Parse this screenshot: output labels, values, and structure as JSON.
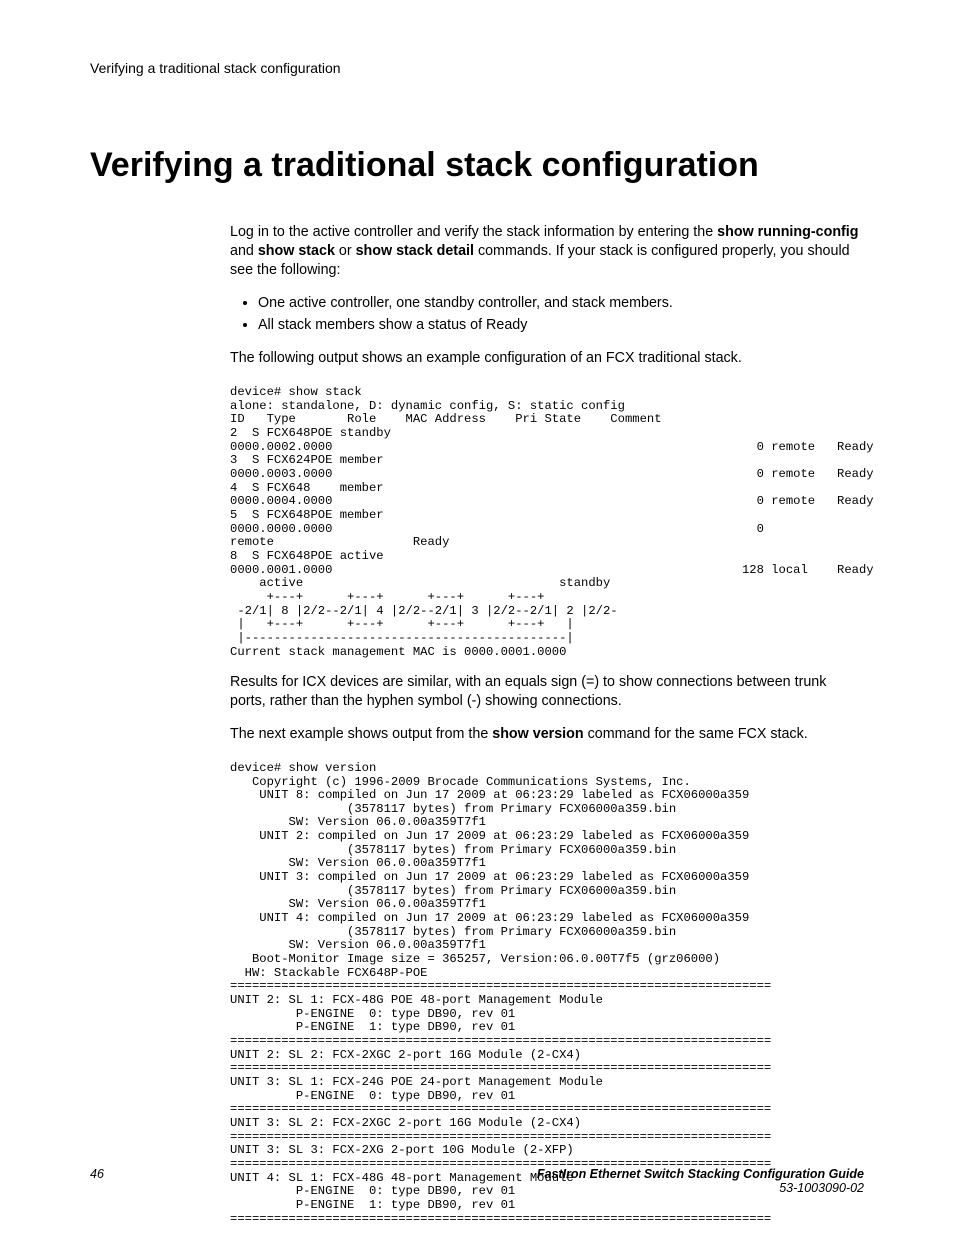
{
  "runningHead": "Verifying a traditional stack configuration",
  "title": "Verifying a traditional stack configuration",
  "intro": {
    "pre1": "Log in to the active controller and verify the stack information by entering the ",
    "cmd1": "show running-config",
    "mid1": " and ",
    "cmd2": "show stack",
    "mid2": " or ",
    "cmd3": "show stack detail",
    "post1": " commands. If your stack is configured properly, you should see the following:"
  },
  "bullets": [
    "One active controller, one standby controller, and stack members.",
    "All stack members show a status of Ready"
  ],
  "para2": "The following output shows an example configuration of an FCX traditional stack.",
  "code1": "device# show stack\nalone: standalone, D: dynamic config, S: static config\nID   Type       Role    MAC Address    Pri State    Comment\n2  S FCX648POE standby\n0000.0002.0000                                                          0 remote   Ready\n3  S FCX624POE member\n0000.0003.0000                                                          0 remote   Ready\n4  S FCX648    member\n0000.0004.0000                                                          0 remote   Ready\n5  S FCX648POE member\n0000.0000.0000                                                          0\nremote                   Ready\n8  S FCX648POE active\n0000.0001.0000                                                        128 local    Ready\n    active                                   standby\n     +---+      +---+      +---+      +---+\n -2/1| 8 |2/2--2/1| 4 |2/2--2/1| 3 |2/2--2/1| 2 |2/2-\n |   +---+      +---+      +---+      +---+   |\n |--------------------------------------------|\nCurrent stack management MAC is 0000.0001.0000",
  "para3": "Results for ICX devices are similar, with an equals sign (=) to show connections between trunk ports, rather than the hyphen symbol (-) showing connections.",
  "para4": {
    "pre": "The next example shows output from the ",
    "cmd": "show version",
    "post": " command for the same FCX stack."
  },
  "code2": "device# show version\n   Copyright (c) 1996-2009 Brocade Communications Systems, Inc.\n    UNIT 8: compiled on Jun 17 2009 at 06:23:29 labeled as FCX06000a359\n                (3578117 bytes) from Primary FCX06000a359.bin\n        SW: Version 06.0.00a359T7f1\n    UNIT 2: compiled on Jun 17 2009 at 06:23:29 labeled as FCX06000a359\n                (3578117 bytes) from Primary FCX06000a359.bin\n        SW: Version 06.0.00a359T7f1\n    UNIT 3: compiled on Jun 17 2009 at 06:23:29 labeled as FCX06000a359\n                (3578117 bytes) from Primary FCX06000a359.bin\n        SW: Version 06.0.00a359T7f1\n    UNIT 4: compiled on Jun 17 2009 at 06:23:29 labeled as FCX06000a359\n                (3578117 bytes) from Primary FCX06000a359.bin\n        SW: Version 06.0.00a359T7f1\n   Boot-Monitor Image size = 365257, Version:06.0.00T7f5 (grz06000)\n  HW: Stackable FCX648P-POE\n==========================================================================\nUNIT 2: SL 1: FCX-48G POE 48-port Management Module\n         P-ENGINE  0: type DB90, rev 01\n         P-ENGINE  1: type DB90, rev 01\n==========================================================================\nUNIT 2: SL 2: FCX-2XGC 2-port 16G Module (2-CX4)\n==========================================================================\nUNIT 3: SL 1: FCX-24G POE 24-port Management Module\n         P-ENGINE  0: type DB90, rev 01\n==========================================================================\nUNIT 3: SL 2: FCX-2XGC 2-port 16G Module (2-CX4)\n==========================================================================\nUNIT 3: SL 3: FCX-2XG 2-port 10G Module (2-XFP)\n==========================================================================\nUNIT 4: SL 1: FCX-48G 48-port Management Module\n         P-ENGINE  0: type DB90, rev 01\n         P-ENGINE  1: type DB90, rev 01\n==========================================================================",
  "footer": {
    "pageNumber": "46",
    "bookTitle": "FastIron Ethernet Switch Stacking Configuration Guide",
    "docNumber": "53-1003090-02"
  }
}
